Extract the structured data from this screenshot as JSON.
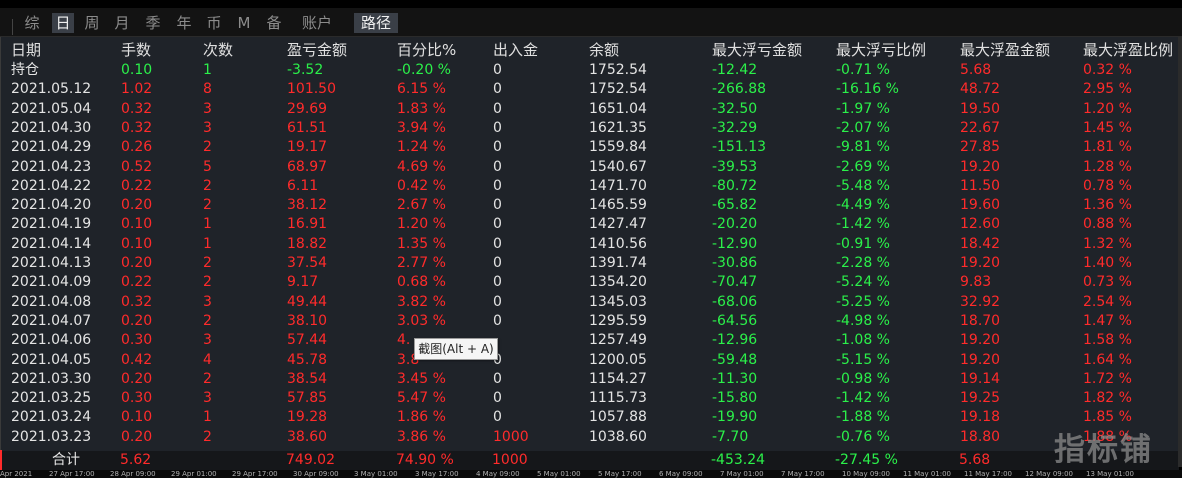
{
  "tabs": [
    {
      "label": "综",
      "active": false
    },
    {
      "label": "日",
      "active": true
    },
    {
      "label": "周",
      "active": false
    },
    {
      "label": "月",
      "active": false
    },
    {
      "label": "季",
      "active": false
    },
    {
      "label": "年",
      "active": false
    },
    {
      "label": "币",
      "active": false
    },
    {
      "label": "M",
      "active": false
    },
    {
      "label": "备",
      "active": false
    },
    {
      "label": "账户",
      "active": false
    },
    {
      "label": "路径",
      "active": true
    }
  ],
  "table": {
    "headers": [
      "日期",
      "手数",
      "次数",
      "盈亏金额",
      "百分比%",
      "出入金",
      "余额",
      "最大浮亏金额",
      "最大浮亏比例",
      "最大浮盈金额",
      "最大浮盈比例"
    ],
    "rows": [
      {
        "date": "持仓",
        "lots": "0.10",
        "count": "1",
        "pnl": "-3.52",
        "pct": "-0.20 %",
        "flow": "0",
        "balance": "1752.54",
        "maxLoss": "-12.42",
        "maxLossPct": "-0.71 %",
        "maxGain": "5.68",
        "maxGainPct": "0.32 %"
      },
      {
        "date": "2021.05.12",
        "lots": "1.02",
        "count": "8",
        "pnl": "101.50",
        "pct": "6.15 %",
        "flow": "0",
        "balance": "1752.54",
        "maxLoss": "-266.88",
        "maxLossPct": "-16.16 %",
        "maxGain": "48.72",
        "maxGainPct": "2.95 %"
      },
      {
        "date": "2021.05.04",
        "lots": "0.32",
        "count": "3",
        "pnl": "29.69",
        "pct": "1.83 %",
        "flow": "0",
        "balance": "1651.04",
        "maxLoss": "-32.50",
        "maxLossPct": "-1.97 %",
        "maxGain": "19.50",
        "maxGainPct": "1.20 %"
      },
      {
        "date": "2021.04.30",
        "lots": "0.32",
        "count": "3",
        "pnl": "61.51",
        "pct": "3.94 %",
        "flow": "0",
        "balance": "1621.35",
        "maxLoss": "-32.29",
        "maxLossPct": "-2.07 %",
        "maxGain": "22.67",
        "maxGainPct": "1.45 %"
      },
      {
        "date": "2021.04.29",
        "lots": "0.26",
        "count": "2",
        "pnl": "19.17",
        "pct": "1.24 %",
        "flow": "0",
        "balance": "1559.84",
        "maxLoss": "-151.13",
        "maxLossPct": "-9.81 %",
        "maxGain": "27.85",
        "maxGainPct": "1.81 %"
      },
      {
        "date": "2021.04.23",
        "lots": "0.52",
        "count": "5",
        "pnl": "68.97",
        "pct": "4.69 %",
        "flow": "0",
        "balance": "1540.67",
        "maxLoss": "-39.53",
        "maxLossPct": "-2.69 %",
        "maxGain": "19.20",
        "maxGainPct": "1.28 %"
      },
      {
        "date": "2021.04.22",
        "lots": "0.22",
        "count": "2",
        "pnl": "6.11",
        "pct": "0.42 %",
        "flow": "0",
        "balance": "1471.70",
        "maxLoss": "-80.72",
        "maxLossPct": "-5.48 %",
        "maxGain": "11.50",
        "maxGainPct": "0.78 %"
      },
      {
        "date": "2021.04.20",
        "lots": "0.20",
        "count": "2",
        "pnl": "38.12",
        "pct": "2.67 %",
        "flow": "0",
        "balance": "1465.59",
        "maxLoss": "-65.82",
        "maxLossPct": "-4.49 %",
        "maxGain": "19.60",
        "maxGainPct": "1.36 %"
      },
      {
        "date": "2021.04.19",
        "lots": "0.10",
        "count": "1",
        "pnl": "16.91",
        "pct": "1.20 %",
        "flow": "0",
        "balance": "1427.47",
        "maxLoss": "-20.20",
        "maxLossPct": "-1.42 %",
        "maxGain": "12.60",
        "maxGainPct": "0.88 %"
      },
      {
        "date": "2021.04.14",
        "lots": "0.10",
        "count": "1",
        "pnl": "18.82",
        "pct": "1.35 %",
        "flow": "0",
        "balance": "1410.56",
        "maxLoss": "-12.90",
        "maxLossPct": "-0.91 %",
        "maxGain": "18.42",
        "maxGainPct": "1.32 %"
      },
      {
        "date": "2021.04.13",
        "lots": "0.20",
        "count": "2",
        "pnl": "37.54",
        "pct": "2.77 %",
        "flow": "0",
        "balance": "1391.74",
        "maxLoss": "-30.86",
        "maxLossPct": "-2.28 %",
        "maxGain": "19.20",
        "maxGainPct": "1.40 %"
      },
      {
        "date": "2021.04.09",
        "lots": "0.22",
        "count": "2",
        "pnl": "9.17",
        "pct": "0.68 %",
        "flow": "0",
        "balance": "1354.20",
        "maxLoss": "-70.47",
        "maxLossPct": "-5.24 %",
        "maxGain": "9.83",
        "maxGainPct": "0.73 %"
      },
      {
        "date": "2021.04.08",
        "lots": "0.32",
        "count": "3",
        "pnl": "49.44",
        "pct": "3.82 %",
        "flow": "0",
        "balance": "1345.03",
        "maxLoss": "-68.06",
        "maxLossPct": "-5.25 %",
        "maxGain": "32.92",
        "maxGainPct": "2.54 %"
      },
      {
        "date": "2021.04.07",
        "lots": "0.20",
        "count": "2",
        "pnl": "38.10",
        "pct": "3.03 %",
        "flow": "0",
        "balance": "1295.59",
        "maxLoss": "-64.56",
        "maxLossPct": "-4.98 %",
        "maxGain": "18.70",
        "maxGainPct": "1.47 %"
      },
      {
        "date": "2021.04.06",
        "lots": "0.30",
        "count": "3",
        "pnl": "57.44",
        "pct": "4.",
        "flow": "",
        "balance": "1257.49",
        "maxLoss": "-12.96",
        "maxLossPct": "-1.08 %",
        "maxGain": "19.20",
        "maxGainPct": "1.58 %"
      },
      {
        "date": "2021.04.05",
        "lots": "0.42",
        "count": "4",
        "pnl": "45.78",
        "pct": "3.8",
        "flow": "0",
        "balance": "1200.05",
        "maxLoss": "-59.48",
        "maxLossPct": "-5.15 %",
        "maxGain": "19.20",
        "maxGainPct": "1.64 %"
      },
      {
        "date": "2021.03.30",
        "lots": "0.20",
        "count": "2",
        "pnl": "38.54",
        "pct": "3.45 %",
        "flow": "0",
        "balance": "1154.27",
        "maxLoss": "-11.30",
        "maxLossPct": "-0.98 %",
        "maxGain": "19.14",
        "maxGainPct": "1.72 %"
      },
      {
        "date": "2021.03.25",
        "lots": "0.30",
        "count": "3",
        "pnl": "57.85",
        "pct": "5.47 %",
        "flow": "0",
        "balance": "1115.73",
        "maxLoss": "-15.80",
        "maxLossPct": "-1.42 %",
        "maxGain": "19.25",
        "maxGainPct": "1.82 %"
      },
      {
        "date": "2021.03.24",
        "lots": "0.10",
        "count": "1",
        "pnl": "19.28",
        "pct": "1.86 %",
        "flow": "0",
        "balance": "1057.88",
        "maxLoss": "-19.90",
        "maxLossPct": "-1.88 %",
        "maxGain": "19.18",
        "maxGainPct": "1.85 %"
      },
      {
        "date": "2021.03.23",
        "lots": "0.20",
        "count": "2",
        "pnl": "38.60",
        "pct": "3.86 %",
        "flow": "1000",
        "balance": "1038.60",
        "maxLoss": "-7.70",
        "maxLossPct": "-0.76 %",
        "maxGain": "18.80",
        "maxGainPct": "1.88 %"
      }
    ],
    "total": {
      "label": "合计",
      "lots": "5.62",
      "pnl": "749.02",
      "pct": "74.90 %",
      "flow": "1000",
      "maxLoss": "-453.24",
      "maxLossPct": "-27.45 %",
      "maxGain": "5.68"
    }
  },
  "tooltip": "截图(Alt + A)",
  "time_axis": [
    "Apr 2021",
    "27 Apr 17:00",
    "28 Apr 09:00",
    "29 Apr 01:00",
    "29 Apr 17:00",
    "30 Apr 09:00",
    "3 May 01:00",
    "3 May 17:00",
    "4 May 09:00",
    "5 May 01:00",
    "5 May 17:00",
    "6 May 09:00",
    "7 May 01:00",
    "7 May 17:00",
    "10 May 09:00",
    "11 May 01:00",
    "11 May 17:00",
    "12 May 09:00",
    "13 May 01:00"
  ],
  "watermark": "指标铺",
  "colors": {
    "positive": "#ff2b2b",
    "negative": "#2bf04a",
    "neutral": "#e4e4e4",
    "panel": "#1f2329"
  }
}
